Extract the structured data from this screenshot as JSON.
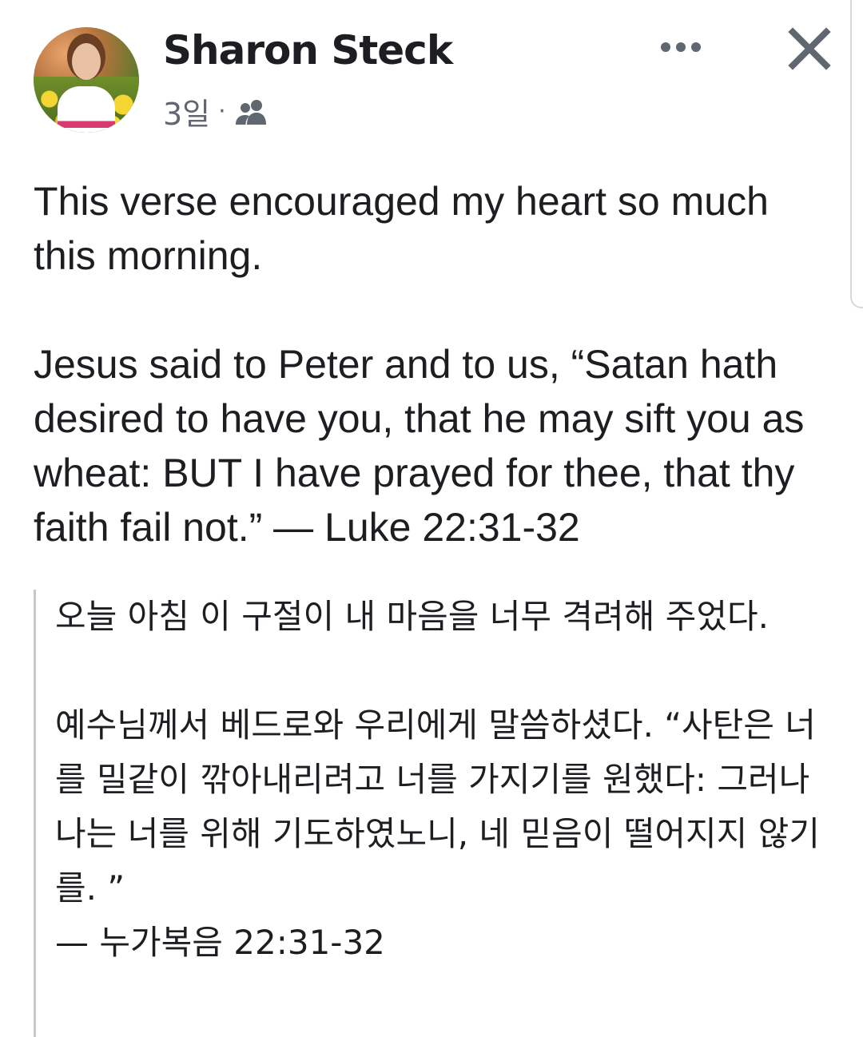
{
  "post": {
    "author": "Sharon Steck",
    "time": "3일",
    "separator": "·",
    "audience_icon": "friends-icon",
    "more_icon": "more-horizontal-icon",
    "close_icon": "close-icon",
    "text": "This verse encouraged my heart so much this morning.\n\nJesus said to Peter and to us, “Satan hath desired to have you, that he may sift you as wheat: BUT I have prayed for thee, that thy faith fail not.” — Luke 22:31-32"
  },
  "translation": {
    "text": "오늘 아침 이 구절이 내 마음을 너무 격려해 주었다.\n\n예수님께서 베드로와 우리에게 말씀하셨다. “사탄은 너를 밀같이 깎아내리려고 너를 가지기를 원했다: 그러나 나는 너를 위해 기도하였노니, 네 믿음이 떨어지지 않기를. ”\n— 누가복음 22:31-32"
  },
  "colors": {
    "text": "#1c1e21",
    "secondary": "#606770",
    "quote_border": "#c6c8cc"
  }
}
